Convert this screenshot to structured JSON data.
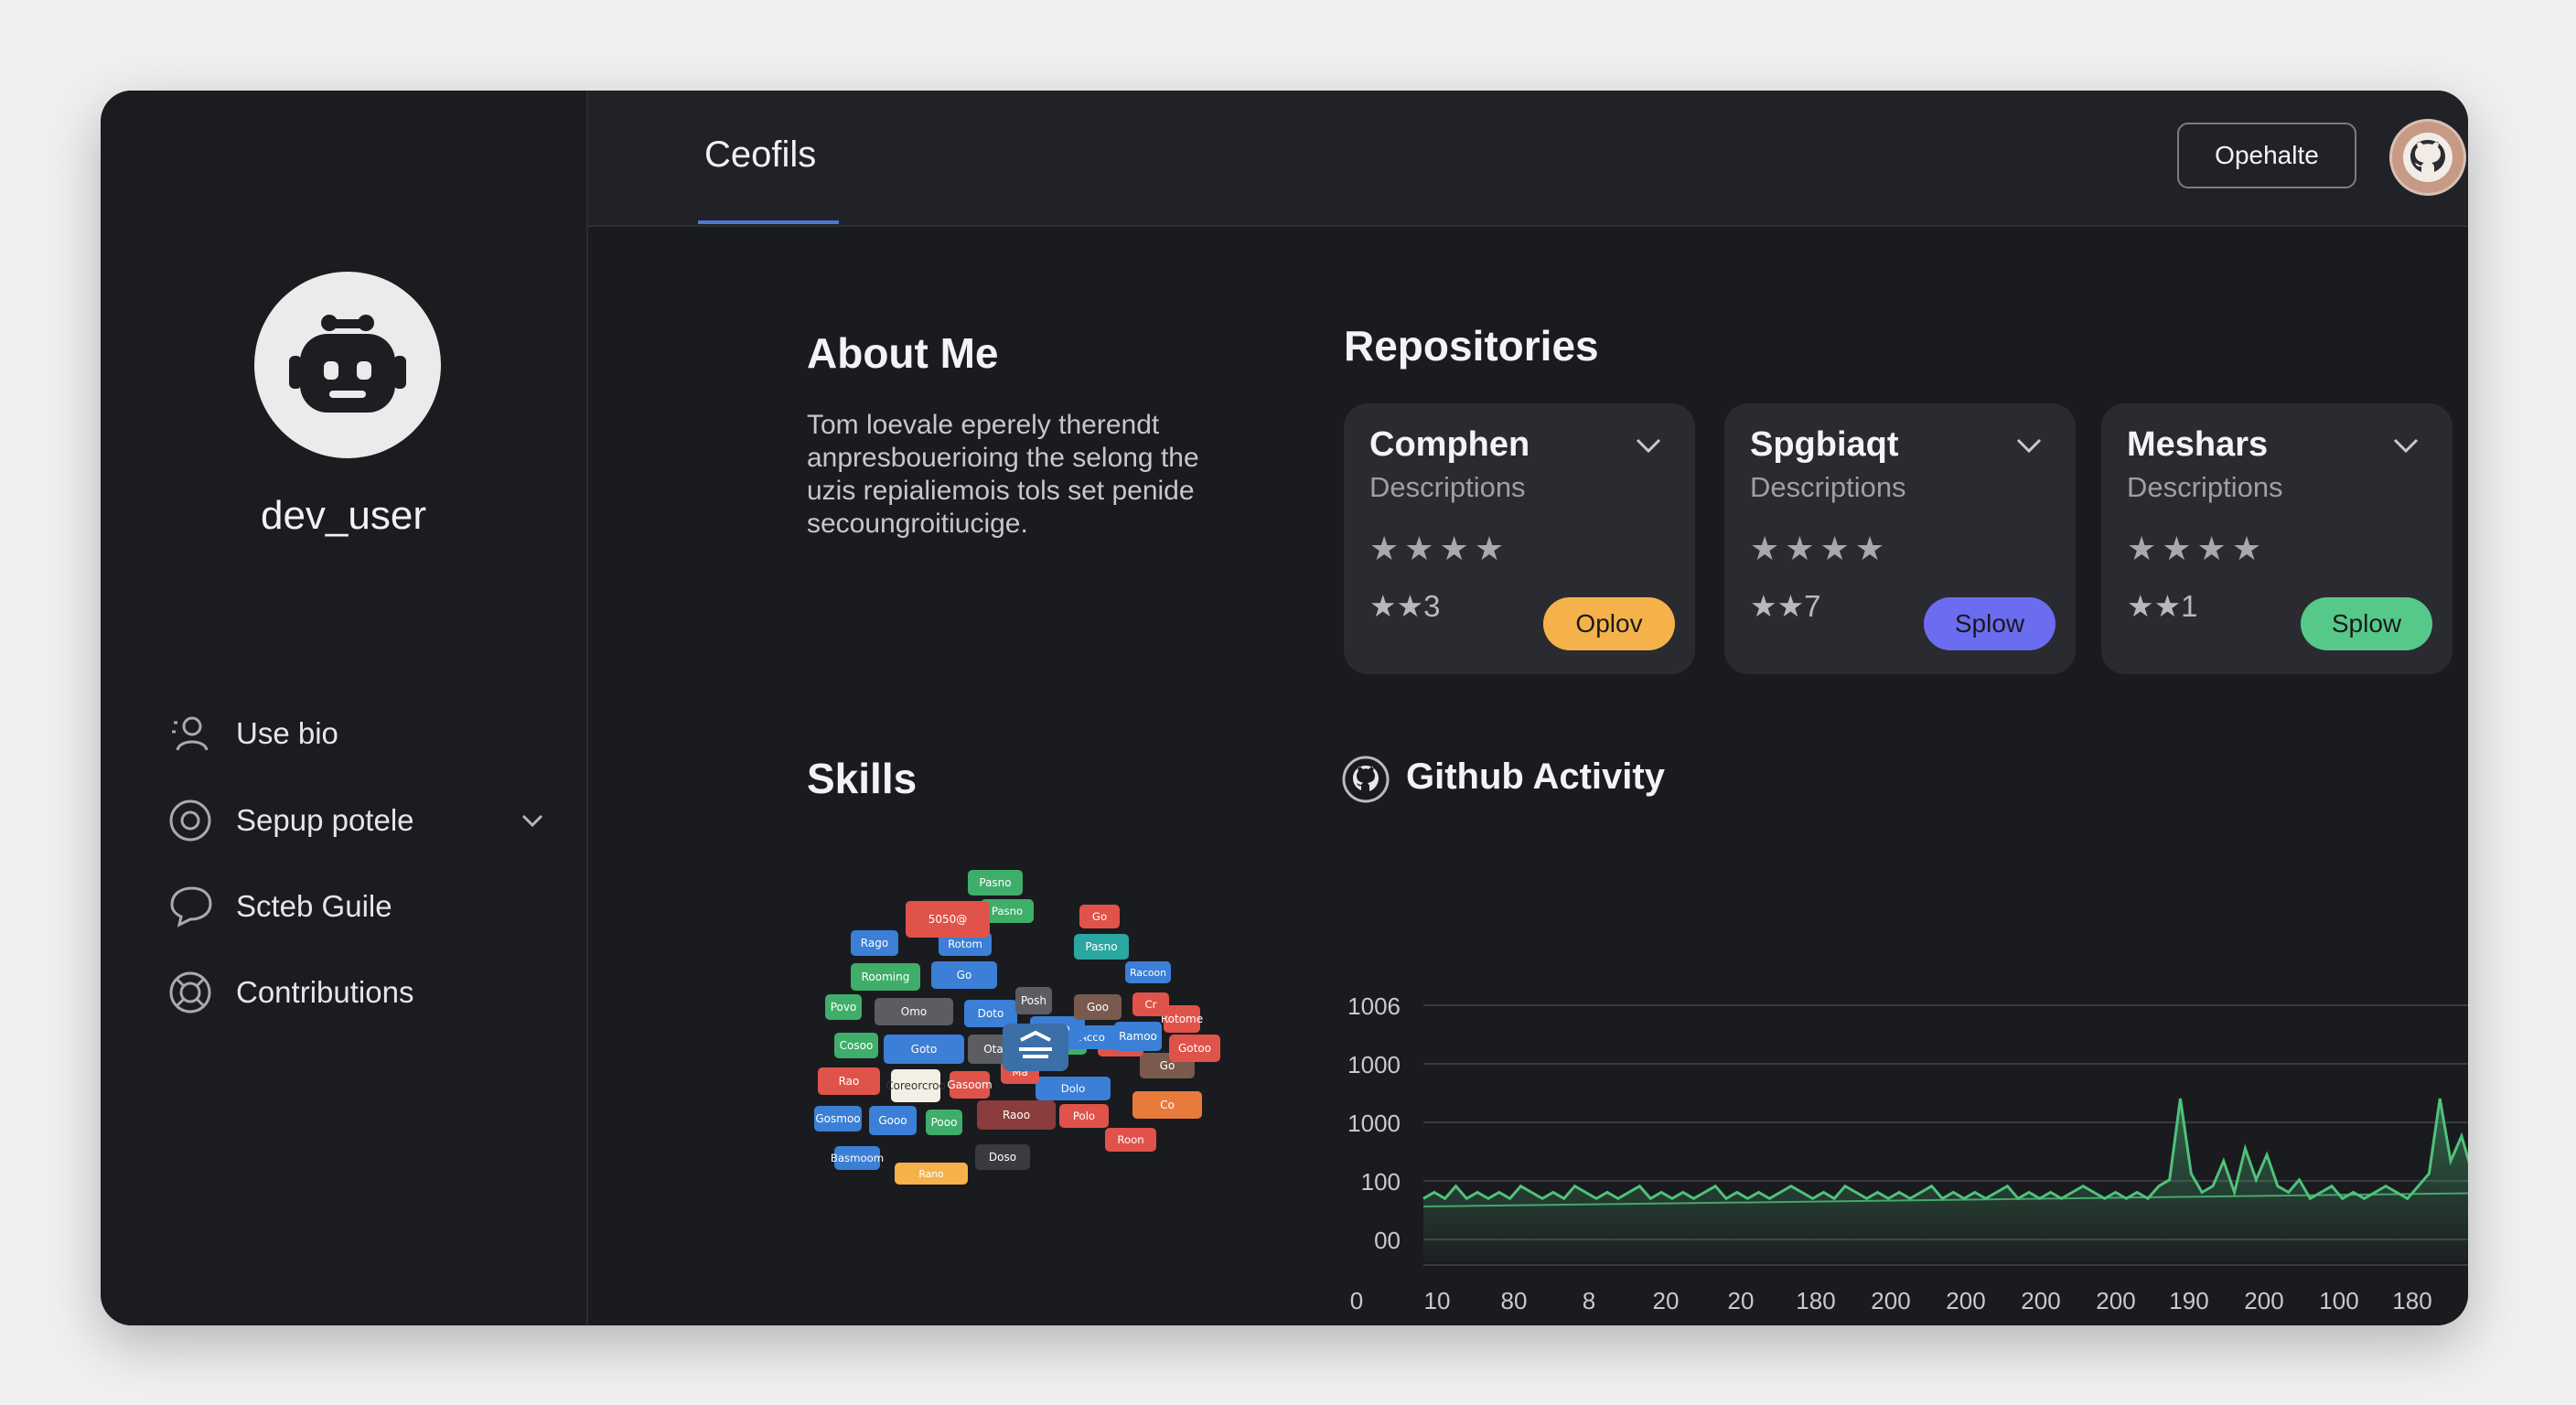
{
  "header": {
    "tab_title": "Ceofils",
    "action_button": "Opehalte"
  },
  "profile": {
    "username": "dev_user"
  },
  "sidebar": {
    "items": [
      {
        "label": "Use bio",
        "icon": "user-icon"
      },
      {
        "label": "Sepup potele",
        "icon": "target-icon",
        "has_chevron": true
      },
      {
        "label": "Scteb Guile",
        "icon": "chat-icon"
      },
      {
        "label": "Contributions",
        "icon": "lifebuoy-icon"
      }
    ]
  },
  "about": {
    "title": "About Me",
    "lines": [
      "Tom loevale eperely therendt",
      "anpresbouerioing the selong the",
      "uzis repialiemois tols set penide",
      "secoungroitiucige."
    ]
  },
  "repositories": {
    "title": "Repositories",
    "items": [
      {
        "name": "Comphen",
        "description": "Descriptions",
        "stars": "★★★★",
        "count": "★★3",
        "button": "Oplov",
        "button_color": "#f6b24a"
      },
      {
        "name": "Spgbiaqt",
        "description": "Descriptions",
        "stars": "★★★★",
        "count": "★★7",
        "button": "Splow",
        "button_color": "#6b6cf0"
      },
      {
        "name": "Meshars",
        "description": "Descriptions",
        "stars": "★★★★",
        "count": "★★1",
        "button": "Splow",
        "button_color": "#56c98a"
      }
    ]
  },
  "skills": {
    "title": "Skills",
    "tags": [
      {
        "text": "Pasno",
        "color": "#3fae6a"
      },
      {
        "text": "5050@",
        "color": "#e0534a"
      },
      {
        "text": "Pasno",
        "color": "#3fae6a"
      },
      {
        "text": "Go",
        "color": "#e0534a"
      },
      {
        "text": "Rago",
        "color": "#3b7fd6"
      },
      {
        "text": "Rotom",
        "color": "#3b7fd6"
      },
      {
        "text": "Pasno",
        "color": "#2aa7a0"
      },
      {
        "text": "Racoon",
        "color": "#3b7fd6"
      },
      {
        "text": "Rooming",
        "color": "#3fae6a"
      },
      {
        "text": "Go",
        "color": "#3b7fd6"
      },
      {
        "text": "Ozen",
        "color": "#e0534a"
      },
      {
        "text": "Posh",
        "color": "#5c5d62"
      },
      {
        "text": "Goo",
        "color": "#7a5a4e"
      },
      {
        "text": "Cr",
        "color": "#e0534a"
      },
      {
        "text": "Rotome",
        "color": "#e0534a"
      },
      {
        "text": "Povo",
        "color": "#3fae6a"
      },
      {
        "text": "Omo",
        "color": "#5c5d62"
      },
      {
        "text": "Doto",
        "color": "#3b7fd6"
      },
      {
        "text": "Poso",
        "color": "#3b7fd6"
      },
      {
        "text": "Acco",
        "color": "#3b7fd6"
      },
      {
        "text": "Ramoo",
        "color": "#3b7fd6"
      },
      {
        "text": "Gotoo",
        "color": "#e0534a"
      },
      {
        "text": "Cosoo",
        "color": "#3fae6a"
      },
      {
        "text": "Goto",
        "color": "#3b7fd6"
      },
      {
        "text": "Otaro",
        "color": "#5c5d62"
      },
      {
        "text": "Espiono",
        "color": "#3fae6a"
      },
      {
        "text": "Roo",
        "color": "#e0534a"
      },
      {
        "text": "Go",
        "color": "#7a5a4e"
      },
      {
        "text": "Rao",
        "color": "#e0534a"
      },
      {
        "text": "Coreorcroo",
        "color": "#f4efe4"
      },
      {
        "text": "Gasoom",
        "color": "#e0534a"
      },
      {
        "text": "Ma",
        "color": "#e0534a"
      },
      {
        "text": "Dolo",
        "color": "#3b7fd6"
      },
      {
        "text": "Co",
        "color": "#e87a3c"
      },
      {
        "text": "Gosmoo",
        "color": "#3b7fd6"
      },
      {
        "text": "Gooo",
        "color": "#3b7fd6"
      },
      {
        "text": "Pooo",
        "color": "#3fae6a"
      },
      {
        "text": "Raoo",
        "color": "#8b3c3c"
      },
      {
        "text": "Polo",
        "color": "#e0534a"
      },
      {
        "text": "Roon",
        "color": "#e0534a"
      },
      {
        "text": "Basmoom",
        "color": "#3b7fd6"
      },
      {
        "text": "Rano",
        "color": "#f6b24a"
      },
      {
        "text": "Doso",
        "color": "#3a3b40"
      }
    ]
  },
  "activity": {
    "title": "Github Activity"
  },
  "chart_data": {
    "type": "area",
    "title": "Github Activity",
    "y_tick_labels": [
      "1006",
      "1000",
      "1000",
      "100",
      "00"
    ],
    "x_tick_labels": [
      "0",
      "10",
      "80",
      "8",
      "20",
      "20",
      "180",
      "200",
      "200",
      "200",
      "200",
      "190",
      "200",
      "100",
      "180"
    ],
    "series": [
      {
        "color": "#4fc27a",
        "values": [
          2,
          3,
          2,
          4,
          2,
          3,
          2,
          3,
          2,
          4,
          3,
          2,
          3,
          2,
          4,
          3,
          2,
          3,
          2,
          3,
          4,
          2,
          3,
          2,
          3,
          2,
          3,
          4,
          2,
          3,
          2,
          3,
          2,
          3,
          4,
          3,
          2,
          3,
          2,
          4,
          3,
          2,
          3,
          2,
          3,
          2,
          3,
          4,
          2,
          3,
          2,
          3,
          2,
          3,
          4,
          2,
          3,
          2,
          3,
          2,
          3,
          4,
          3,
          2,
          3,
          2,
          3,
          2,
          4,
          5,
          18,
          6,
          3,
          4,
          8,
          3,
          10,
          5,
          9,
          4,
          3,
          5,
          2,
          3,
          4,
          2,
          3,
          2,
          3,
          4,
          3,
          2,
          4,
          6,
          18,
          8,
          12,
          6,
          10,
          5,
          14,
          4,
          6,
          3,
          4,
          8,
          4,
          3,
          5,
          3,
          2,
          3,
          4,
          3,
          2,
          3,
          4,
          3,
          6,
          9,
          4,
          7,
          3,
          6,
          10,
          5,
          3,
          6,
          8,
          26,
          9,
          5,
          18,
          4,
          3,
          4,
          2,
          5,
          3,
          4,
          6
        ]
      }
    ],
    "ylim": [
      0,
      30
    ],
    "grid": true
  }
}
